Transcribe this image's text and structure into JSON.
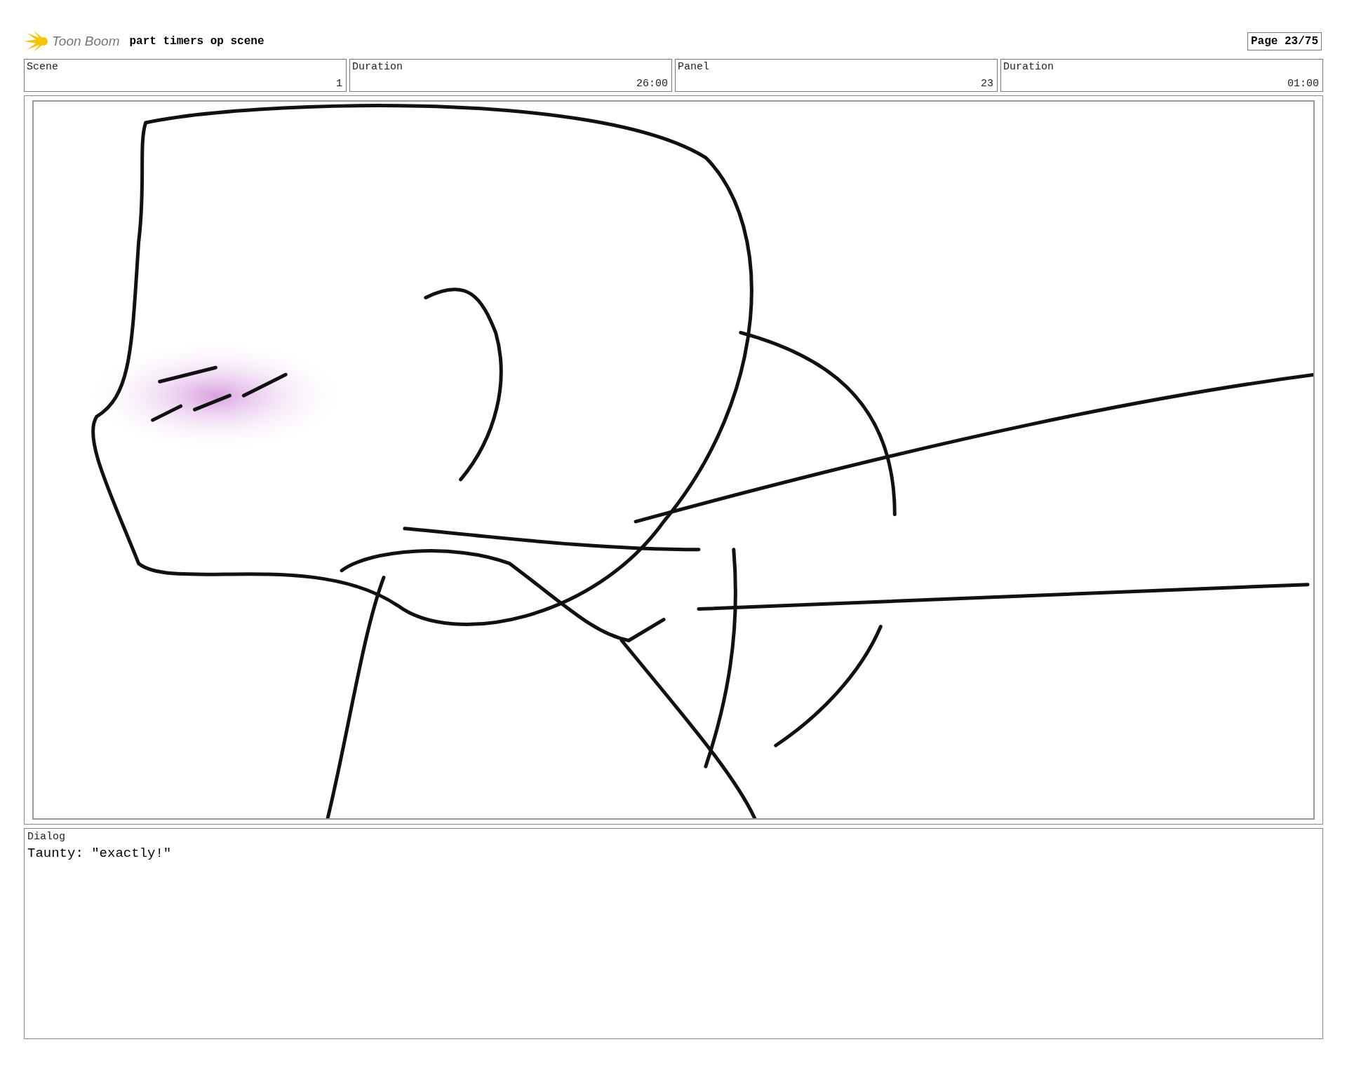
{
  "header": {
    "logo_text": "Toon Boom",
    "title": "part timers op scene",
    "page": "Page 23/75"
  },
  "info": [
    {
      "label": "Scene",
      "value": "1"
    },
    {
      "label": "Duration",
      "value": "26:00"
    },
    {
      "label": "Panel",
      "value": "23"
    },
    {
      "label": "Duration",
      "value": "01:00"
    }
  ],
  "dialog": {
    "label": "Dialog",
    "text": "Taunty: \"exactly!\""
  }
}
